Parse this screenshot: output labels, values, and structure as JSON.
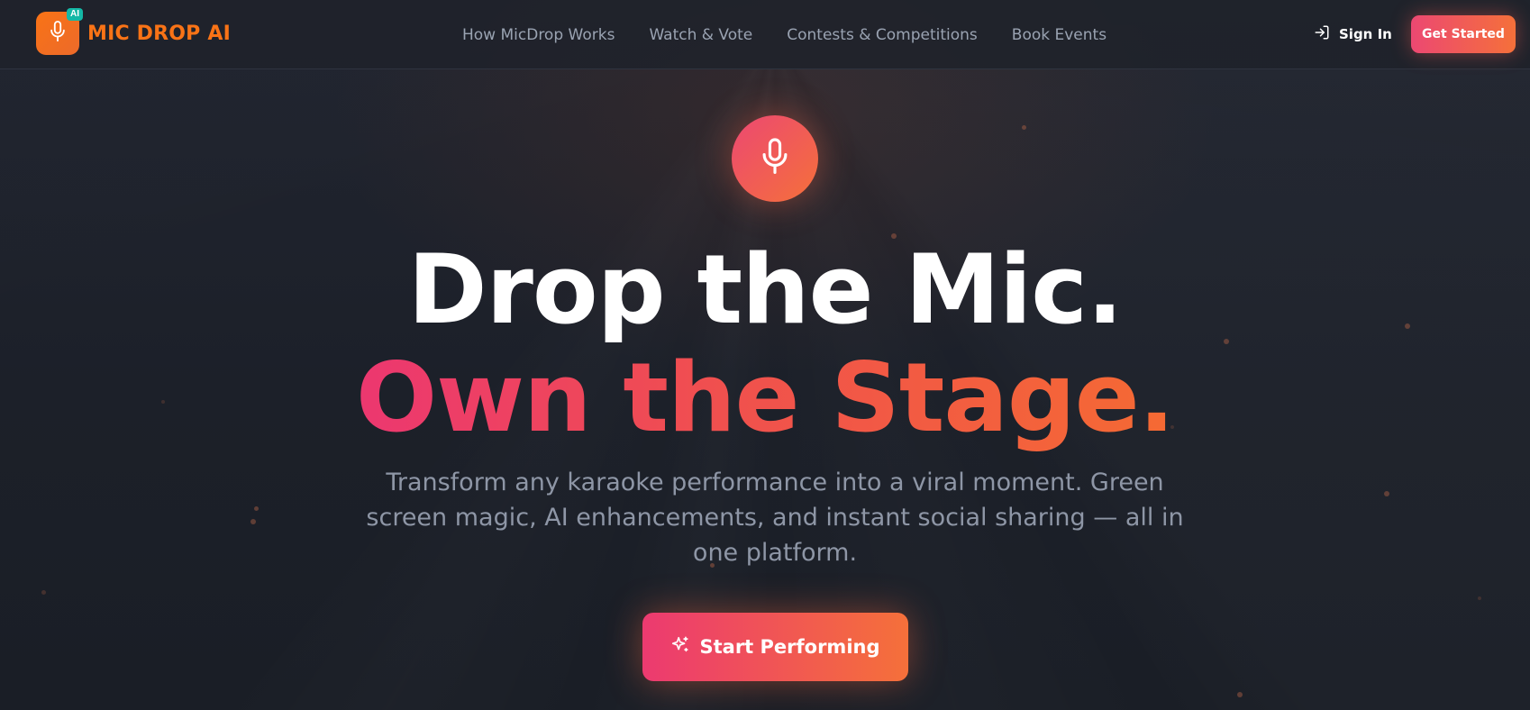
{
  "brand": {
    "name": "MIC DROP AI",
    "badge": "AI",
    "logo_icon": "microphone-icon",
    "color": "#f97316"
  },
  "nav": {
    "links": [
      {
        "label": "How MicDrop Works"
      },
      {
        "label": "Watch & Vote"
      },
      {
        "label": "Contests & Competitions"
      },
      {
        "label": "Book Events"
      }
    ],
    "sign_in": {
      "label": "Sign In",
      "icon": "sign-in-icon"
    },
    "get_started": {
      "label": "Get Started"
    }
  },
  "hero": {
    "icon": "microphone-icon",
    "headline_line1": "Drop the Mic.",
    "headline_line2": "Own the Stage.",
    "subtitle": "Transform any karaoke performance into a viral moment. Green screen magic, AI enhancements, and instant social sharing — all in one platform.",
    "cta": {
      "label": "Start Performing",
      "icon": "sparkle-icon"
    }
  },
  "colors": {
    "background": "#1b1f27",
    "accent_pink": "#ec4872",
    "accent_orange": "#f5703a",
    "badge_teal": "#14b8a6",
    "nav_text": "#9aa3b2"
  }
}
